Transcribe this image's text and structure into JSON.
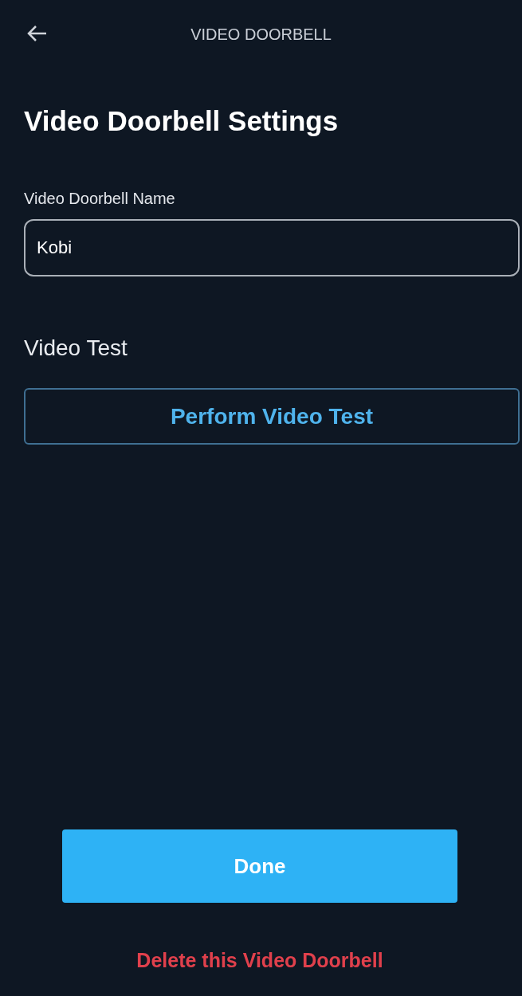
{
  "header": {
    "title": "VIDEO DOORBELL"
  },
  "heading": "Video Doorbell Settings",
  "name_field": {
    "label": "Video Doorbell Name",
    "value": "Kobi"
  },
  "video_test": {
    "title": "Video Test",
    "button": "Perform Video Test"
  },
  "done_button": "Done",
  "delete_link": "Delete this Video Doorbell"
}
